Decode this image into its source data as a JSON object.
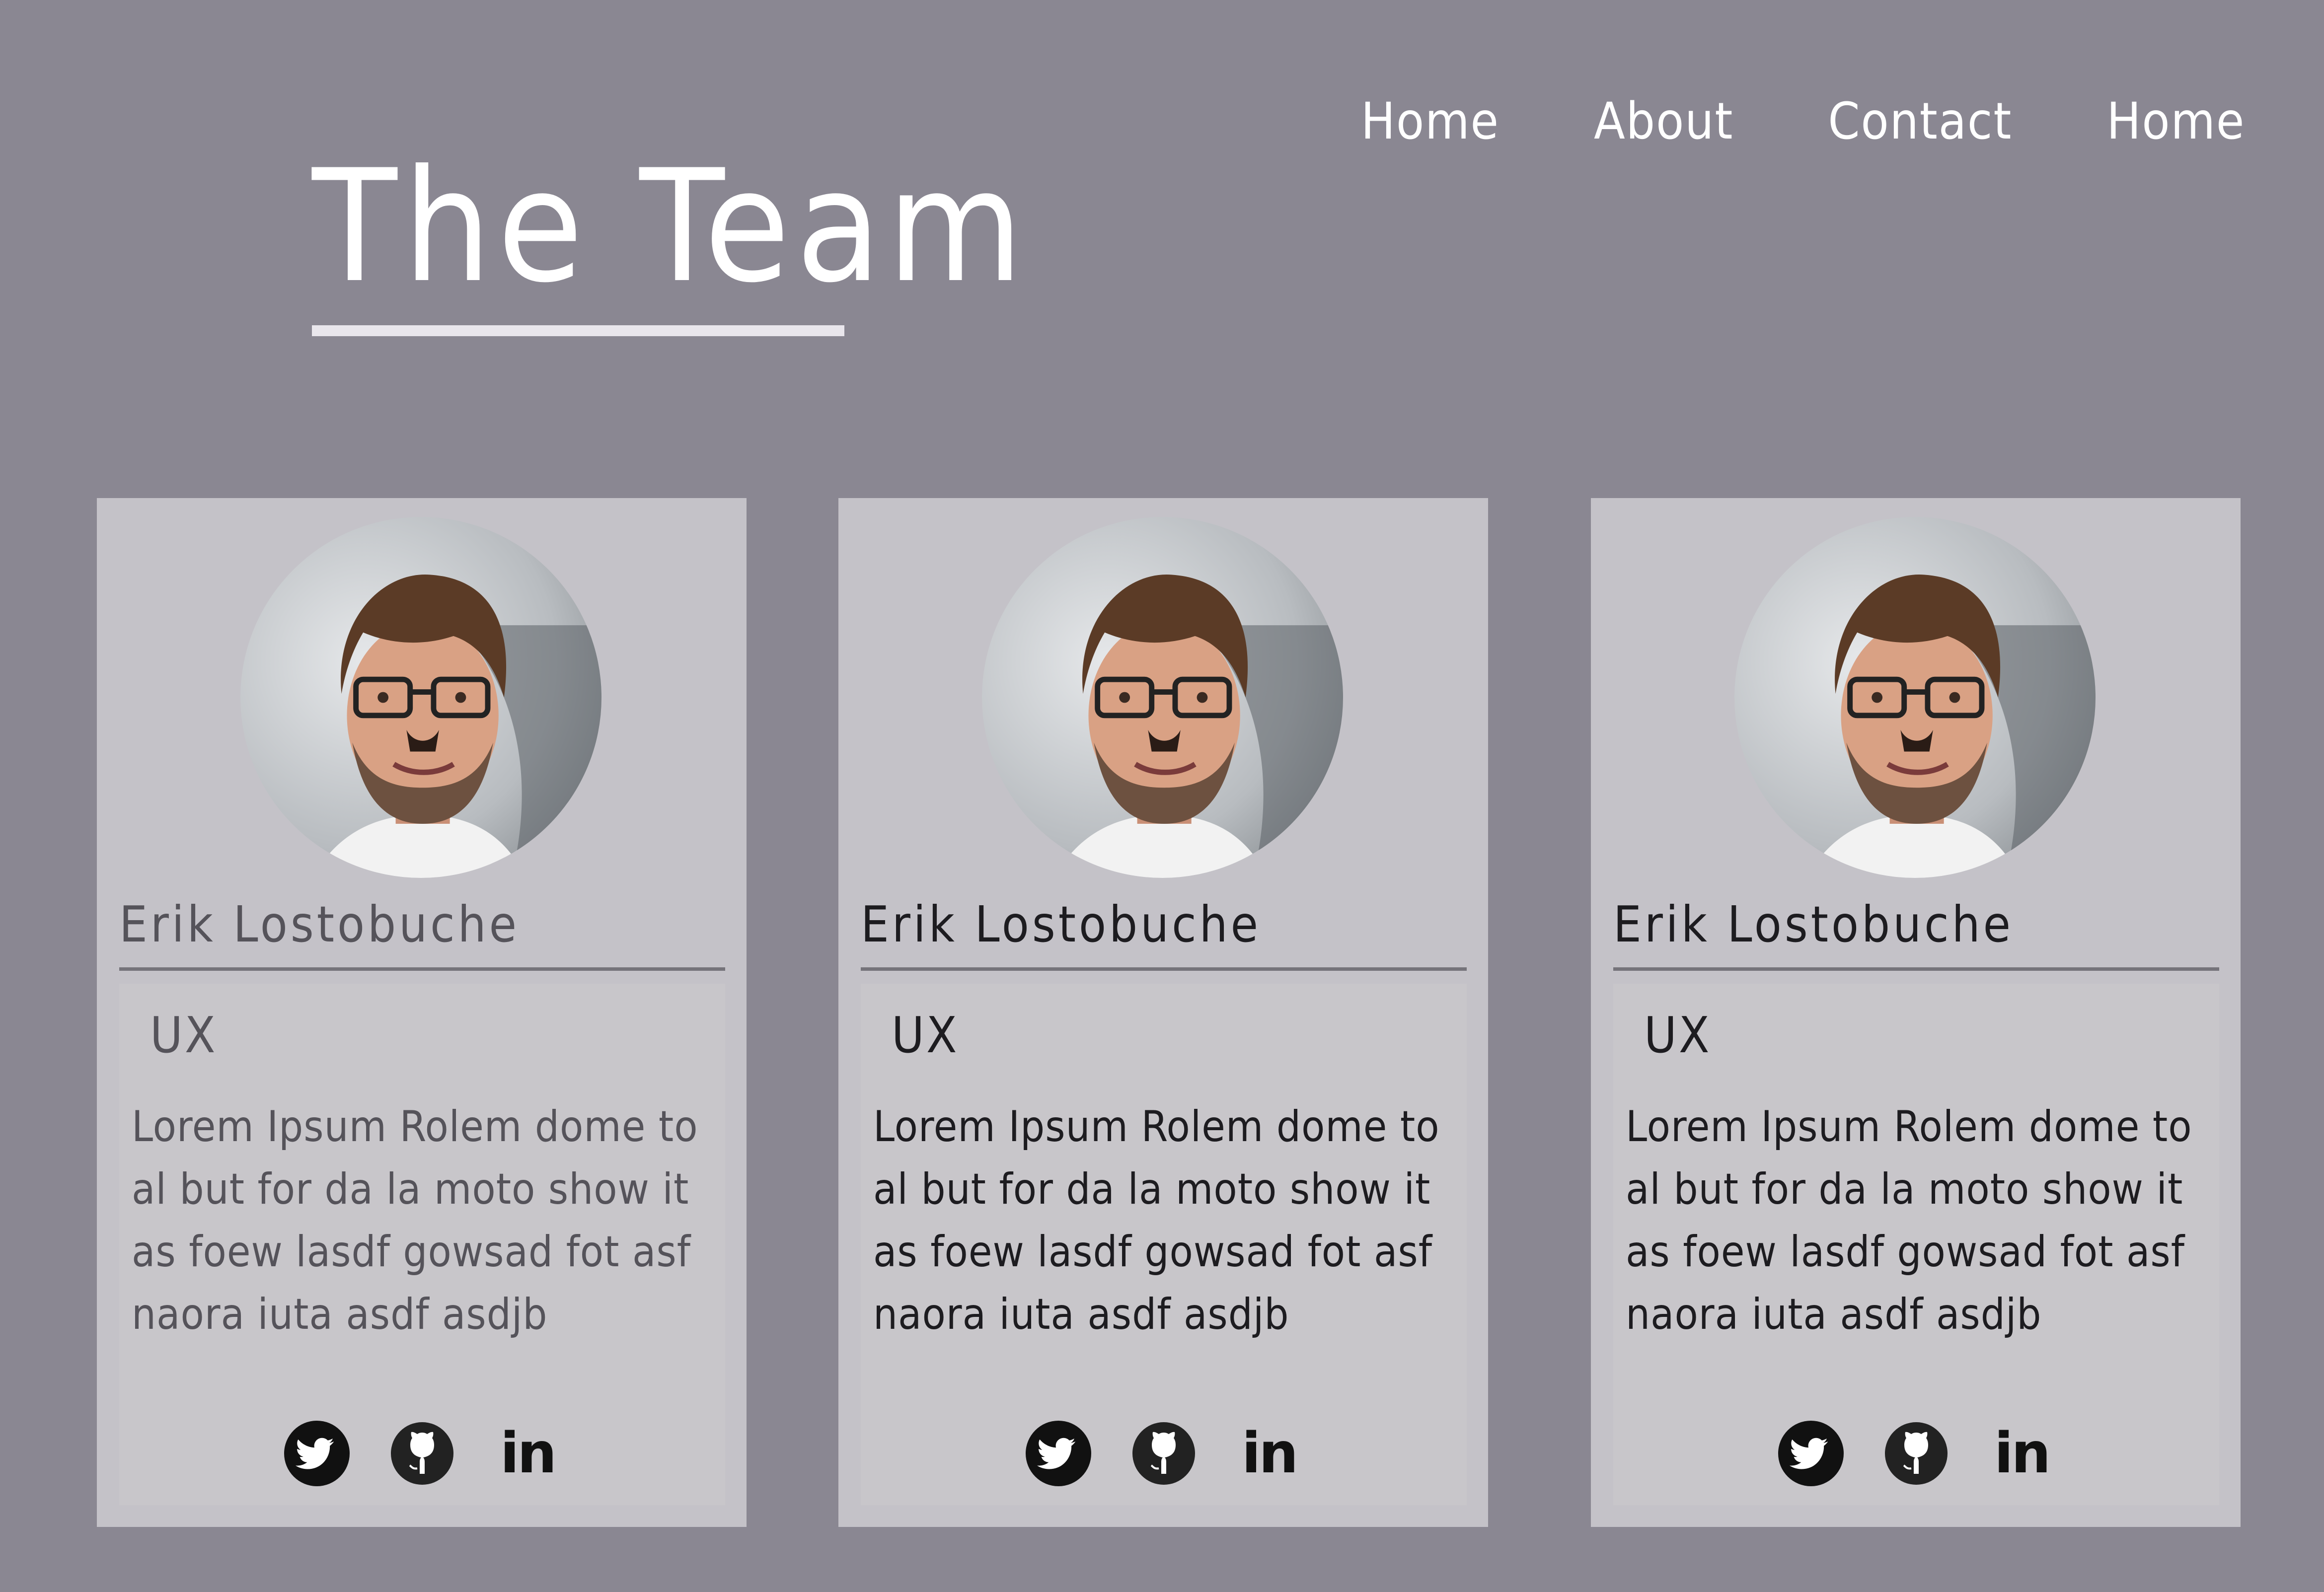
{
  "nav": {
    "items": [
      {
        "label": "Home"
      },
      {
        "label": "About"
      },
      {
        "label": "Contact"
      },
      {
        "label": "Home"
      }
    ]
  },
  "page": {
    "title": "The Team"
  },
  "cards": [
    {
      "name": "Erik Lostobuche",
      "role": "UX",
      "bio": "Lorem Ipsum Rolem dome to al but for da la moto show it as foew lasdf gowsad fot asf naora iuta asdf asdjb",
      "social": [
        "twitter-icon",
        "github-icon",
        "linkedin-icon"
      ],
      "linkedin_text": "in"
    },
    {
      "name": "Erik Lostobuche",
      "role": "UX",
      "bio": "Lorem Ipsum Rolem dome to al but for da la moto show it as foew lasdf gowsad fot asf naora iuta asdf asdjb",
      "social": [
        "twitter-icon",
        "github-icon",
        "linkedin-icon"
      ],
      "linkedin_text": "in"
    },
    {
      "name": "Erik Lostobuche",
      "role": "UX",
      "bio": "Lorem Ipsum Rolem dome to al but for da la moto show it as foew lasdf gowsad fot asf naora iuta asdf asdjb",
      "social": [
        "twitter-icon",
        "github-icon",
        "linkedin-icon"
      ],
      "linkedin_text": "in"
    }
  ],
  "colors": {
    "background": "#8a8792",
    "card": "#c4c2c8",
    "info_box": "#c8c6ca",
    "text_dark": "#1d1c20",
    "text_muted": "#55535a",
    "white": "#ffffff"
  }
}
